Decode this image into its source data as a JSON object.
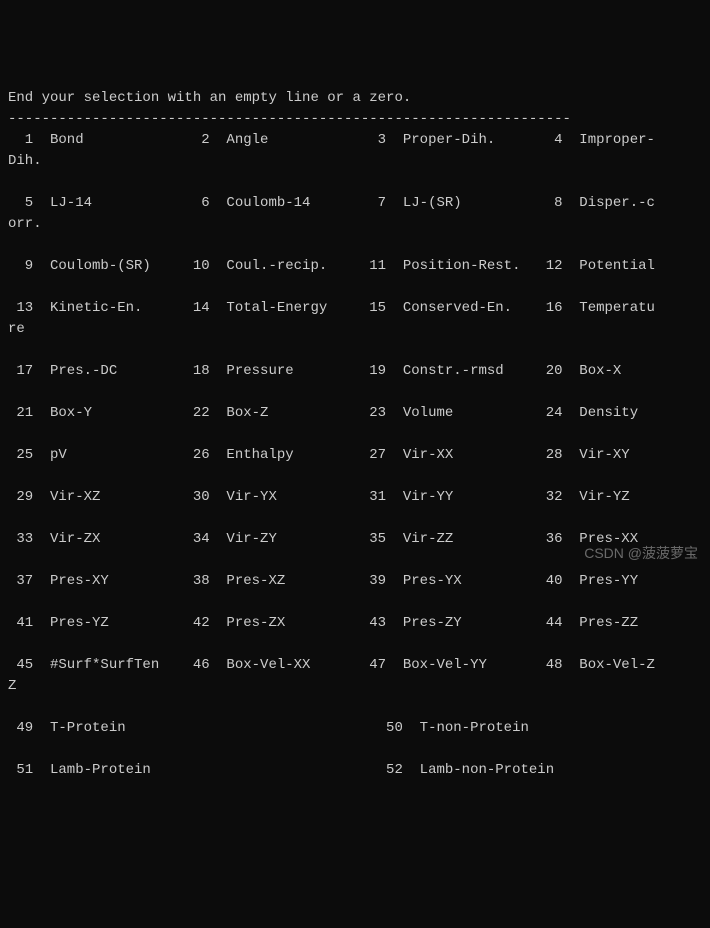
{
  "header": "End your selection with an empty line or a zero.",
  "separator": "-------------------------------------------------------------------",
  "entries": [
    {
      "num": 1,
      "label": "Bond"
    },
    {
      "num": 2,
      "label": "Angle"
    },
    {
      "num": 3,
      "label": "Proper-Dih."
    },
    {
      "num": 4,
      "label": "Improper-Dih."
    },
    {
      "num": 5,
      "label": "LJ-14"
    },
    {
      "num": 6,
      "label": "Coulomb-14"
    },
    {
      "num": 7,
      "label": "LJ-(SR)"
    },
    {
      "num": 8,
      "label": "Disper.-corr."
    },
    {
      "num": 9,
      "label": "Coulomb-(SR)"
    },
    {
      "num": 10,
      "label": "Coul.-recip."
    },
    {
      "num": 11,
      "label": "Position-Rest."
    },
    {
      "num": 12,
      "label": "Potential"
    },
    {
      "num": 13,
      "label": "Kinetic-En."
    },
    {
      "num": 14,
      "label": "Total-Energy"
    },
    {
      "num": 15,
      "label": "Conserved-En."
    },
    {
      "num": 16,
      "label": "Temperature"
    },
    {
      "num": 17,
      "label": "Pres.-DC"
    },
    {
      "num": 18,
      "label": "Pressure"
    },
    {
      "num": 19,
      "label": "Constr.-rmsd"
    },
    {
      "num": 20,
      "label": "Box-X"
    },
    {
      "num": 21,
      "label": "Box-Y"
    },
    {
      "num": 22,
      "label": "Box-Z"
    },
    {
      "num": 23,
      "label": "Volume"
    },
    {
      "num": 24,
      "label": "Density"
    },
    {
      "num": 25,
      "label": "pV"
    },
    {
      "num": 26,
      "label": "Enthalpy"
    },
    {
      "num": 27,
      "label": "Vir-XX"
    },
    {
      "num": 28,
      "label": "Vir-XY"
    },
    {
      "num": 29,
      "label": "Vir-XZ"
    },
    {
      "num": 30,
      "label": "Vir-YX"
    },
    {
      "num": 31,
      "label": "Vir-YY"
    },
    {
      "num": 32,
      "label": "Vir-YZ"
    },
    {
      "num": 33,
      "label": "Vir-ZX"
    },
    {
      "num": 34,
      "label": "Vir-ZY"
    },
    {
      "num": 35,
      "label": "Vir-ZZ"
    },
    {
      "num": 36,
      "label": "Pres-XX"
    },
    {
      "num": 37,
      "label": "Pres-XY"
    },
    {
      "num": 38,
      "label": "Pres-XZ"
    },
    {
      "num": 39,
      "label": "Pres-YX"
    },
    {
      "num": 40,
      "label": "Pres-YY"
    },
    {
      "num": 41,
      "label": "Pres-YZ"
    },
    {
      "num": 42,
      "label": "Pres-ZX"
    },
    {
      "num": 43,
      "label": "Pres-ZY"
    },
    {
      "num": 44,
      "label": "Pres-ZZ"
    },
    {
      "num": 45,
      "label": "#Surf*SurfTen"
    },
    {
      "num": 46,
      "label": "Box-Vel-XX"
    },
    {
      "num": 47,
      "label": "Box-Vel-YY"
    },
    {
      "num": 48,
      "label": "Box-Vel-ZZ"
    },
    {
      "num": 49,
      "label": "T-Protein"
    },
    {
      "num": 50,
      "label": "T-non-Protein"
    },
    {
      "num": 51,
      "label": "Lamb-Protein"
    },
    {
      "num": 52,
      "label": "Lamb-non-Protein"
    }
  ],
  "layout": {
    "wrapWidth": 77,
    "numWidth": 3,
    "gap": "  ",
    "labelWidth": 14,
    "perRowNormal": 4,
    "perRowWide": 2,
    "wideStartNum": 49
  },
  "watermark": "CSDN @菠菠萝宝"
}
